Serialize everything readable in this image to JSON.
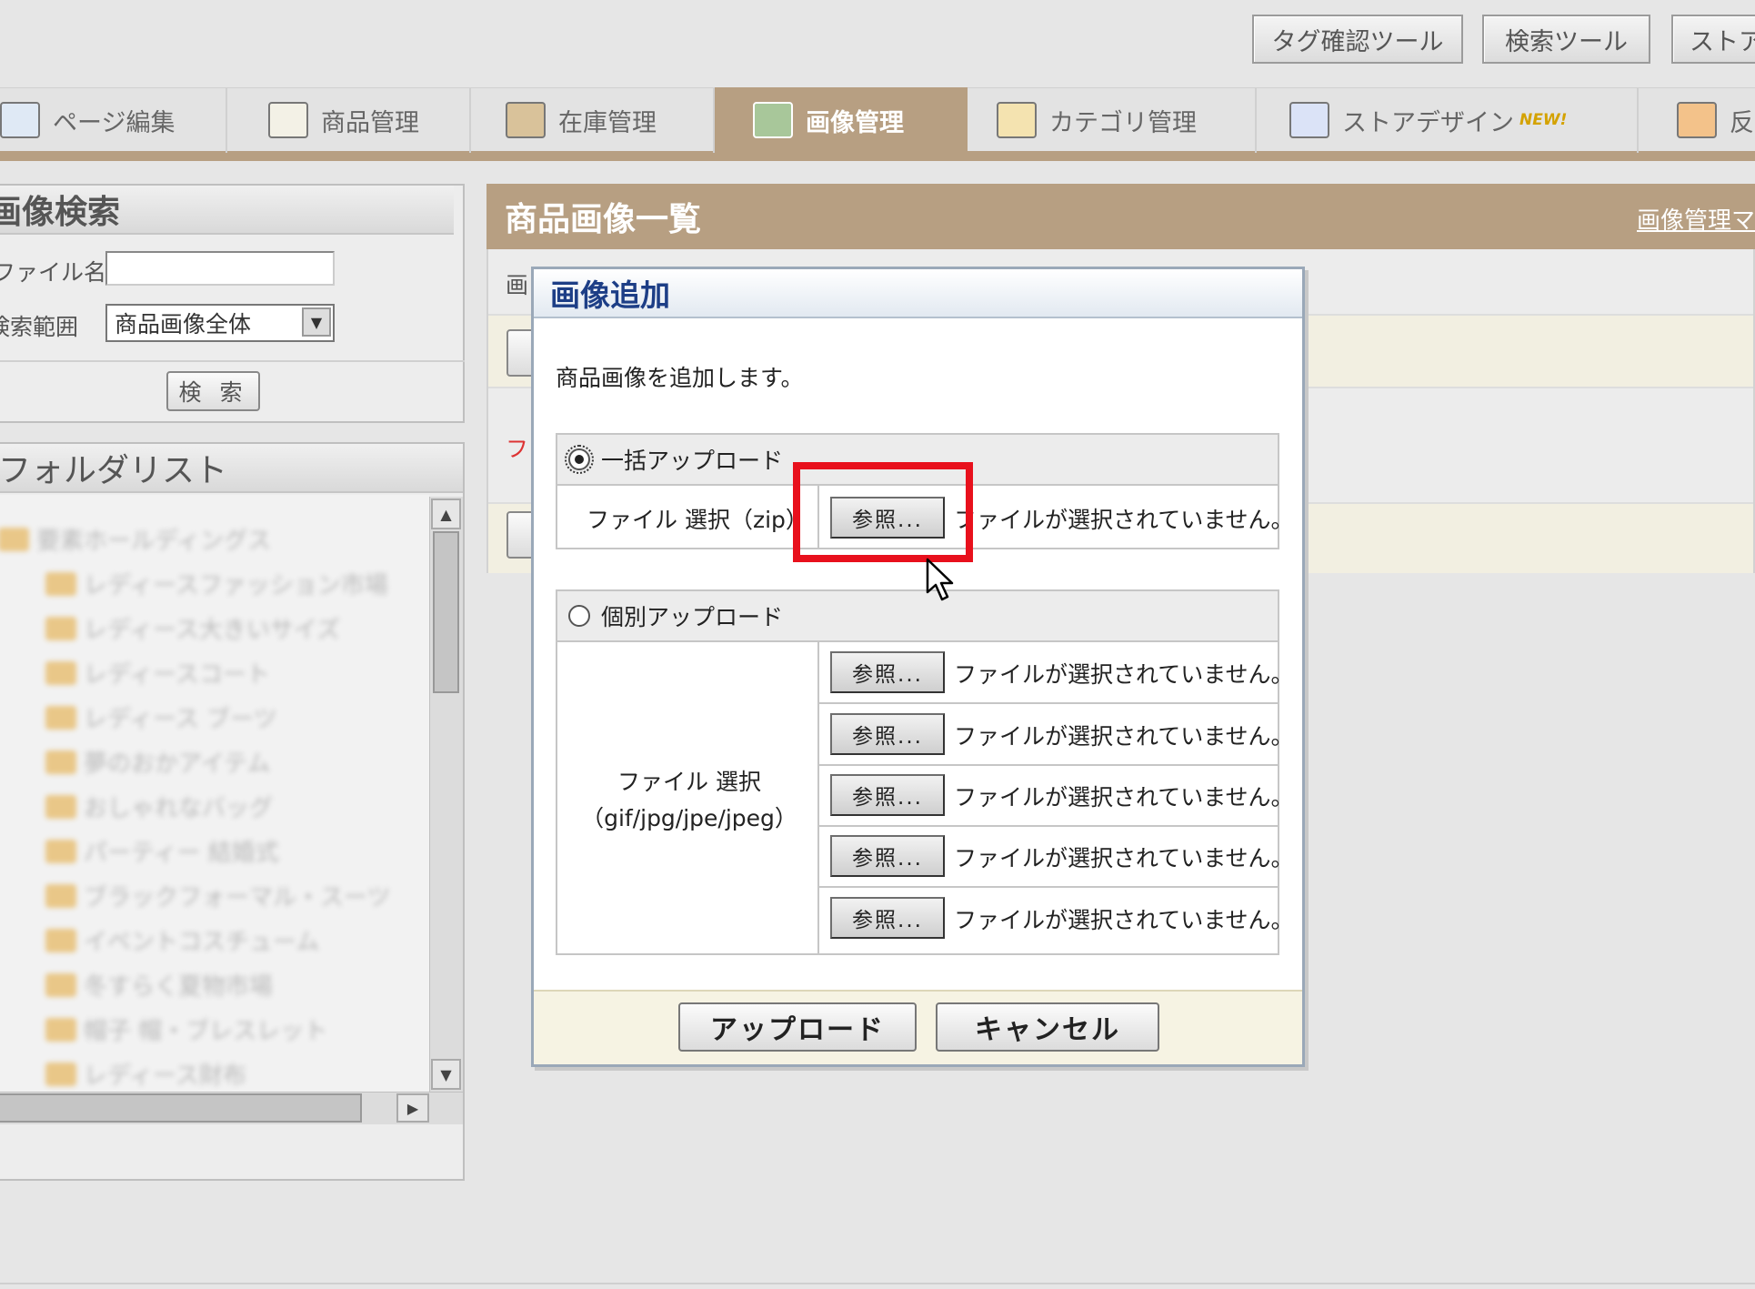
{
  "tools": {
    "tag_check": "タグ確認ツール",
    "search_tool": "検索ツール",
    "store": "ストア"
  },
  "tabs": [
    {
      "label": "ページ編集",
      "active": false
    },
    {
      "label": "商品管理",
      "active": false
    },
    {
      "label": "在庫管理",
      "active": false
    },
    {
      "label": "画像管理",
      "active": true
    },
    {
      "label": "カテゴリ管理",
      "active": false
    },
    {
      "label": "ストアデザイン",
      "badge": "NEW!",
      "active": false
    },
    {
      "label": "反",
      "active": false
    }
  ],
  "search_panel": {
    "title": "画像検索",
    "file_name_label": "ファイル名",
    "file_name_value": "",
    "range_label": "検索範囲",
    "range_value": "商品画像全体",
    "search_button": "検 索"
  },
  "folder_panel": {
    "title": "フォルダリスト",
    "items": [
      "要素ホールディングス",
      "レディースファッション市場",
      "レディース大きいサイズ",
      "レディースコート",
      "レディース ブーツ",
      "夢のおかアイテム",
      "おしゃれなバッグ",
      "パーティー 結婚式",
      "ブラックフォーマル・スーツ",
      "イベントコスチューム",
      "冬すらく夏物市場",
      "帽子 帽・ブレスレット",
      "レディース財布"
    ]
  },
  "list_panel": {
    "title": "商品画像一覧",
    "manual_link": "画像管理マ",
    "partial_label": "画",
    "partial_red": "フ"
  },
  "modal": {
    "title": "画像追加",
    "description": "商品画像を追加します。",
    "bulk": {
      "label": "一括アップロード",
      "selected": true,
      "file_label": "ファイル 選択（zip）",
      "browse": "参照...",
      "status": "ファイルが選択されていません。"
    },
    "individual": {
      "label": "個別アップロード",
      "selected": false,
      "file_label_line1": "ファイル 選択",
      "file_label_line2": "（gif/jpg/jpe/jpeg）",
      "rows": [
        {
          "browse": "参照...",
          "status": "ファイルが選択されていません。"
        },
        {
          "browse": "参照...",
          "status": "ファイルが選択されていません。"
        },
        {
          "browse": "参照...",
          "status": "ファイルが選択されていません。"
        },
        {
          "browse": "参照...",
          "status": "ファイルが選択されていません。"
        },
        {
          "browse": "参照...",
          "status": "ファイルが選択されていません。"
        }
      ]
    },
    "upload_button": "アップロード",
    "cancel_button": "キャンセル"
  },
  "colors": {
    "accent": "#b79f82",
    "highlight": "#e8101c",
    "modal_title": "#1d3e86"
  }
}
